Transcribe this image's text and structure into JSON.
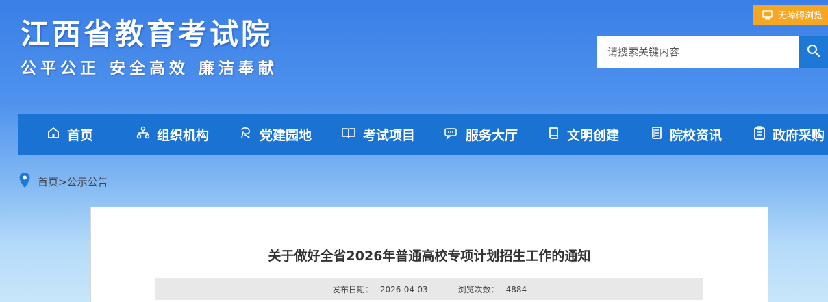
{
  "header": {
    "site_title": "江西省教育考试院",
    "slogan": "公平公正 安全高效 廉洁奉献",
    "accessibility_label": "无障碍浏览",
    "search_placeholder": "请搜索关键内容"
  },
  "nav": {
    "items": [
      {
        "label": "首页",
        "icon": "home-icon"
      },
      {
        "label": "组织机构",
        "icon": "org-chart-icon"
      },
      {
        "label": "党建园地",
        "icon": "party-building-icon"
      },
      {
        "label": "考试项目",
        "icon": "open-book-icon"
      },
      {
        "label": "服务大厅",
        "icon": "service-hall-icon"
      },
      {
        "label": "文明创建",
        "icon": "book-icon"
      },
      {
        "label": "院校资讯",
        "icon": "document-icon"
      },
      {
        "label": "政府采购",
        "icon": "clipboard-icon"
      }
    ]
  },
  "breadcrumb": {
    "home": "首页",
    "separator": ">",
    "current": "公示公告"
  },
  "article": {
    "title": "关于做好全省2026年普通高校专项计划招生工作的通知",
    "publish_label": "发布日期：",
    "publish_date": "2026-04-03",
    "views_label": "浏览次数：",
    "views_count": "4884"
  },
  "colors": {
    "nav_bg": "#1a72d2",
    "accessibility_bg": "#f5a623",
    "search_button_bg": "#1e78d6",
    "location_pin": "#1e78d6"
  }
}
